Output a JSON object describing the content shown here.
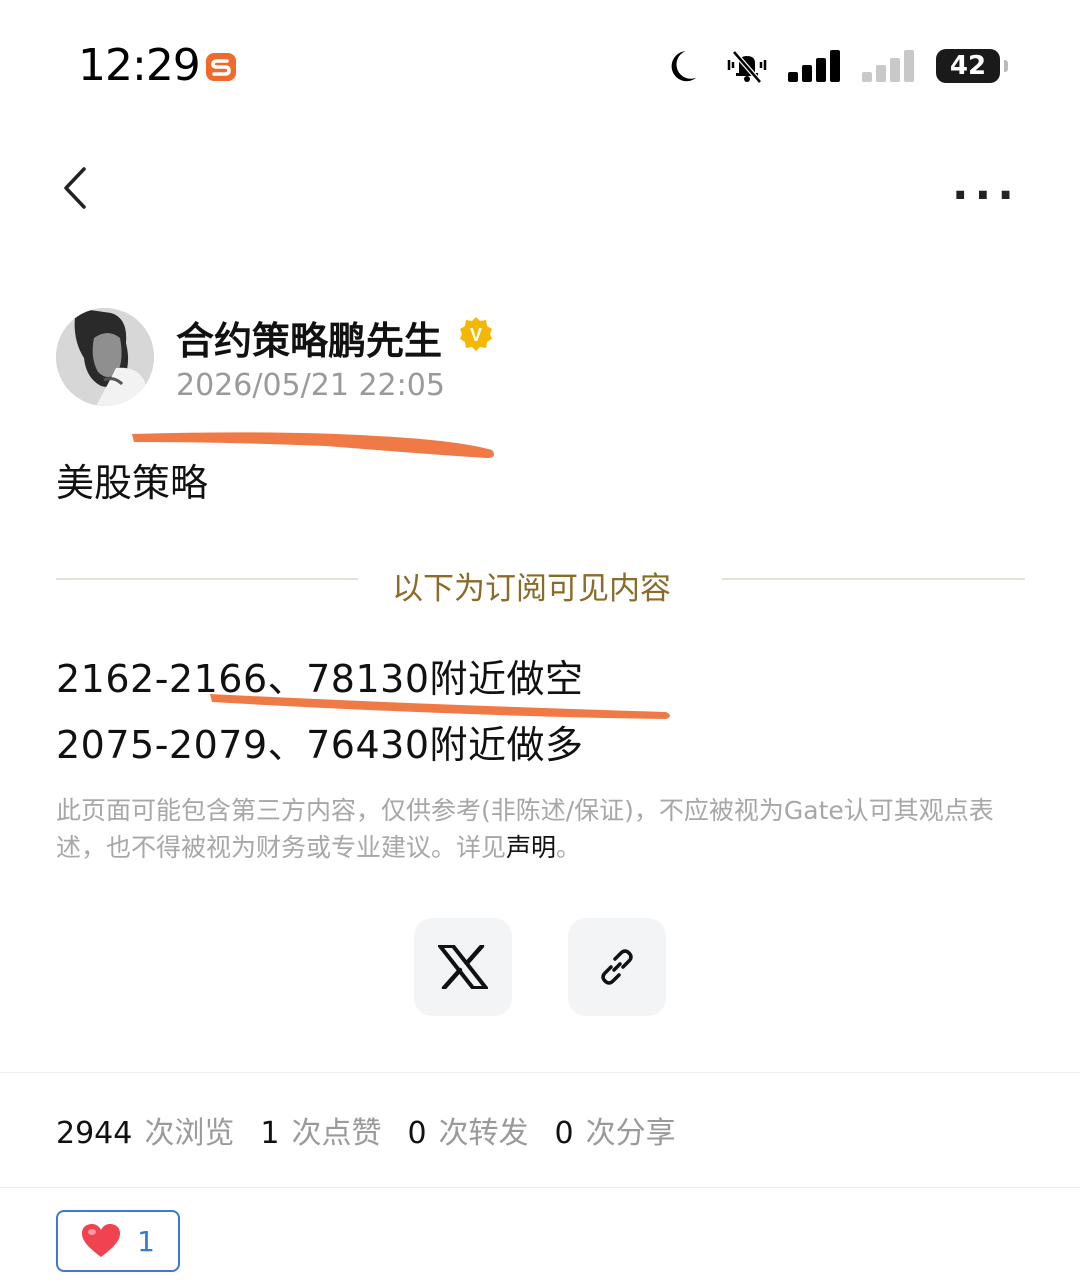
{
  "status_bar": {
    "time": "12:29",
    "battery": "42"
  },
  "author": {
    "name": "合约策略鹏先生",
    "timestamp": "2026/05/21 22:05",
    "verified_badge": "V"
  },
  "post": {
    "title": "美股策略",
    "subscriber_divider_label": "以下为订阅可见内容",
    "lines": [
      "2162-2166、78130附近做空",
      "2075-2079、76430附近做多"
    ]
  },
  "disclaimer": {
    "text": "此页面可能包含第三方内容，仅供参考(非陈述/保证)，不应被视为Gate认可其观点表述，也不得被视为财务或专业建议。详见",
    "link": "声明",
    "end": "。"
  },
  "stats": [
    {
      "count": "2944",
      "label": "次浏览"
    },
    {
      "count": "1",
      "label": "次点赞"
    },
    {
      "count": "0",
      "label": "次转发"
    },
    {
      "count": "0",
      "label": "次分享"
    }
  ],
  "like_button": {
    "count": "1"
  },
  "icons": {
    "back": "chevron-left-icon",
    "more": "more-horizontal-icon",
    "share_x": "x-logo-icon",
    "copy_link": "link-icon",
    "like": "heart-icon"
  },
  "colors": {
    "accent_gold": "#8a6b2a",
    "annotation": "#f07a45",
    "like_border": "#3a79d6",
    "verified": "#f5b800"
  }
}
